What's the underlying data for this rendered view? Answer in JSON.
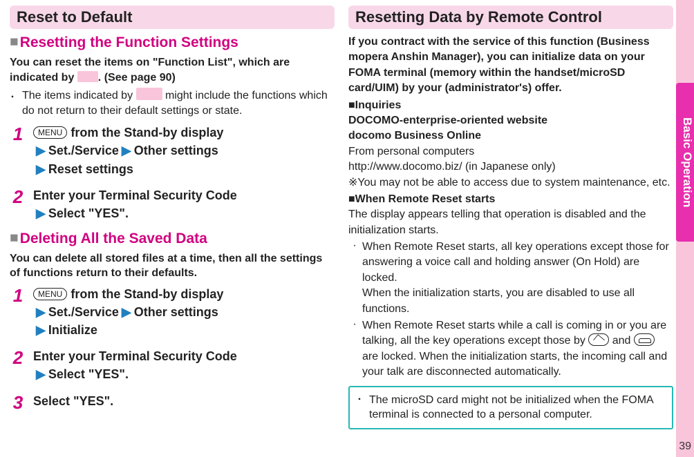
{
  "page_number": "39",
  "side_tab": "Basic Operation",
  "left": {
    "title": "Reset to Default",
    "sub1": "Resetting the Function Settings",
    "intro1a": "You can reset the items on \"Function List\", which are indicated by ",
    "intro1b": ". (See page 90)",
    "bullet1a": "The items indicated by ",
    "bullet1b": " might include the functions which do not return to their default settings or state.",
    "s1_pre": " from the Stand-by display",
    "s1_l2a": "Set./Service",
    "s1_l2b": "Other settings",
    "s1_l3": "Reset settings",
    "s2_l1": "Enter your Terminal Security Code",
    "s2_l2": "Select \"YES\".",
    "sub2": "Deleting All the Saved Data",
    "intro2": "You can delete all stored files at a time, then all the settings of functions return to their defaults.",
    "d1_pre": " from the Stand-by display",
    "d1_l2a": "Set./Service",
    "d1_l2b": "Other settings",
    "d1_l3": "Initialize",
    "d2_l1": "Enter your Terminal Security Code",
    "d2_l2": "Select \"YES\".",
    "d3": "Select \"YES\"."
  },
  "right": {
    "title": "Resetting Data by Remote Control",
    "p1": "If you contract with the service of this function (Business mopera Anshin Manager), you can initialize data on your FOMA terminal (memory within the handset/microSD card/UIM) by your (administrator's) offer.",
    "inq_head": "Inquiries",
    "inq_l1": "DOCOMO-enterprise-oriented website",
    "inq_l2": "docomo Business Online",
    "inq_l3": "From personal computers",
    "inq_l4": "http://www.docomo.biz/ (in Japanese only)",
    "inq_l5": "※You may not be able to access due to system maintenance, etc.",
    "rr_head": "When Remote Reset starts",
    "rr_body": "The display appears telling that operation is disabled and the initialization starts.",
    "rr_d1a": "When Remote Reset starts, all key operations except those for answering a voice call and holding answer (On Hold) are locked.",
    "rr_d1b": "When the initialization starts, you are disabled to use all functions.",
    "rr_d2a": "When Remote Reset starts while a call is coming in or you are talking, all the key operations except those by ",
    "rr_d2b": " and ",
    "rr_d2c": " are locked. When the initialization starts, the incoming call and your talk are disconnected automatically.",
    "note": "The microSD card might not be initialized when the FOMA terminal is connected to a personal computer."
  },
  "keys": {
    "menu": "MENU"
  }
}
